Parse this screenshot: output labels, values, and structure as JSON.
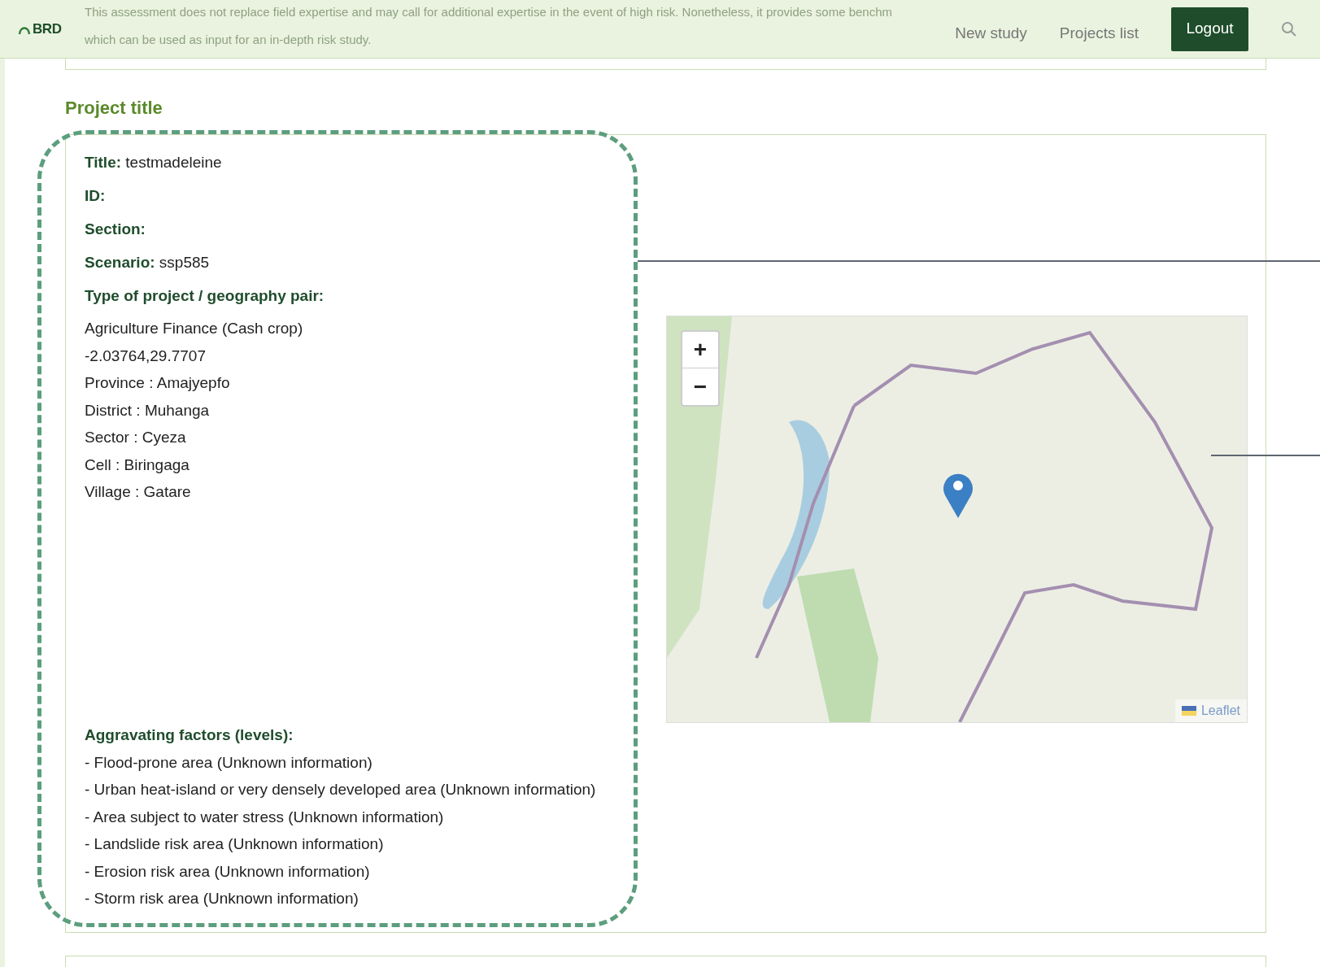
{
  "header": {
    "logo": "BRD",
    "notice": [
      "This assessment does not replace field expertise and may call for additional expertise in the event of high risk. Nonetheless, it provides some benchm",
      "which can be used as input for an in-depth risk study."
    ],
    "nav": [
      "New study",
      "Projects list"
    ],
    "logout": "Logout"
  },
  "section_title": "Project title",
  "fields": [
    {
      "label": "Title:",
      "value": "testmadeleine"
    },
    {
      "label": "ID:"
    },
    {
      "label": "Section:"
    },
    {
      "label": "Scenario:",
      "value": "ssp585"
    }
  ],
  "pair_heading": "Type of project / geography pair:",
  "pair_lines": [
    "Agriculture Finance (Cash crop)",
    "-2.03764,29.7707",
    "Province : Amajyepfo",
    "District : Muhanga",
    "Sector : Cyeza",
    "Cell : Biringaga",
    "Village : Gatare"
  ],
  "factors_heading": "Aggravating factors (levels):",
  "factors": [
    "- Flood-prone area (Unknown information)",
    "- Urban heat-island or very densely developed area (Unknown information)",
    "- Area subject to water stress (Unknown information)",
    "- Landslide risk area (Unknown information)",
    "- Erosion risk area (Unknown information)",
    "- Storm risk area (Unknown information)"
  ],
  "map": {
    "zoom_in": "+",
    "zoom_out": "−",
    "attribution": "Leaflet"
  }
}
